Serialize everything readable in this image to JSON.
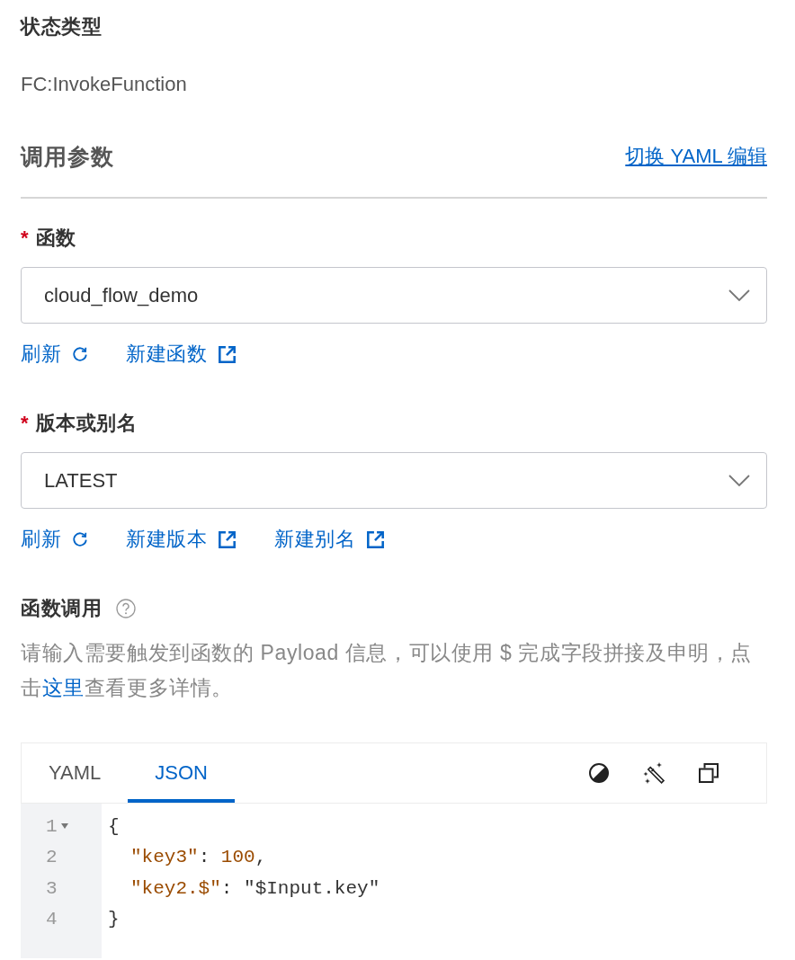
{
  "status_type": {
    "label": "状态类型",
    "value": "FC:InvokeFunction"
  },
  "invoke_params": {
    "title": "调用参数",
    "link": "切换 YAML 编辑"
  },
  "fields": [
    {
      "required_mark": "*",
      "label": "函数",
      "value": "cloud_flow_demo",
      "actions": [
        {
          "kind": "refresh",
          "label": "刷新"
        },
        {
          "kind": "external",
          "label": "新建函数"
        }
      ]
    },
    {
      "required_mark": "*",
      "label": "版本或别名",
      "value": "LATEST",
      "actions": [
        {
          "kind": "refresh",
          "label": "刷新"
        },
        {
          "kind": "external",
          "label": "新建版本"
        },
        {
          "kind": "external",
          "label": "新建别名"
        }
      ]
    }
  ],
  "function_invocation": {
    "title": "函数调用",
    "description": {
      "before": "请输入需要触发到函数的 Payload 信息，可以使用 $ 完成字段拼接及申明，点击",
      "link": "这里",
      "after": "查看更多详情。"
    }
  },
  "editor": {
    "tabs": [
      {
        "label": "YAML",
        "selected": false
      },
      {
        "label": "JSON",
        "selected": true
      }
    ],
    "lines": [
      {
        "number": "1",
        "fold": {
          "expanded": true
        },
        "indented": false,
        "tokens": [
          {
            "kind": "punct",
            "text": "{"
          }
        ]
      },
      {
        "number": "2",
        "indented": true,
        "tokens": [
          {
            "kind": "key",
            "text": "\"key3\""
          },
          {
            "kind": "punct",
            "text": ": "
          },
          {
            "kind": "number",
            "text": "100"
          },
          {
            "kind": "punct",
            "text": ","
          }
        ]
      },
      {
        "number": "3",
        "indented": true,
        "tokens": [
          {
            "kind": "key",
            "text": "\"key2.$\""
          },
          {
            "kind": "punct",
            "text": ": "
          },
          {
            "kind": "string",
            "text": "\"$Input.key\""
          }
        ]
      },
      {
        "number": "4",
        "indented": false,
        "tokens": [
          {
            "kind": "punct",
            "text": "}"
          }
        ]
      }
    ]
  }
}
